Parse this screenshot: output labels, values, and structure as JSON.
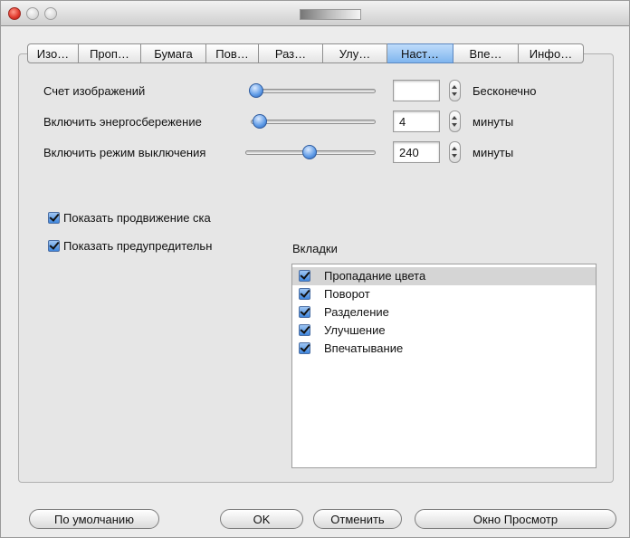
{
  "tabs": [
    {
      "label": "Изо…"
    },
    {
      "label": "Проп…"
    },
    {
      "label": "Бумага"
    },
    {
      "label": "Пов…"
    },
    {
      "label": "Раз…"
    },
    {
      "label": "Улу…"
    },
    {
      "label": "Наст…"
    },
    {
      "label": "Впе…"
    },
    {
      "label": "Инфо…"
    }
  ],
  "active_tab_index": 6,
  "settings": {
    "image_count": {
      "label": "Счет изображений",
      "value": "",
      "unit": "Бесконечно",
      "slider_level": 0.0
    },
    "power_save": {
      "label": "Включить энергосбережение",
      "value": "4",
      "unit": "минуты",
      "slider_level": 0.03
    },
    "power_off": {
      "label": "Включить режим выключения",
      "value": "240",
      "unit": "минуты",
      "slider_level": 0.5
    }
  },
  "options": {
    "show_progress": {
      "label": "Показать продвижение ска",
      "checked": true
    },
    "show_warning": {
      "label": "Показать предупредительн",
      "checked": true
    }
  },
  "tabs_list": {
    "heading": "Вкладки",
    "items": [
      {
        "label": "Пропадание цвета",
        "checked": true,
        "selected": true
      },
      {
        "label": "Поворот",
        "checked": true,
        "selected": false
      },
      {
        "label": "Разделение",
        "checked": true,
        "selected": false
      },
      {
        "label": "Улучшение",
        "checked": true,
        "selected": false
      },
      {
        "label": "Впечатывание",
        "checked": true,
        "selected": false
      }
    ]
  },
  "buttons": {
    "defaults": "По умолчанию",
    "ok": "OK",
    "cancel": "Отменить",
    "preview": "Окно Просмотр"
  },
  "colors": {
    "window_bg": "#ececec",
    "active_tab": "#7fb5ee",
    "checkbox": "#3f86dd",
    "close_button": "#e0362a"
  }
}
